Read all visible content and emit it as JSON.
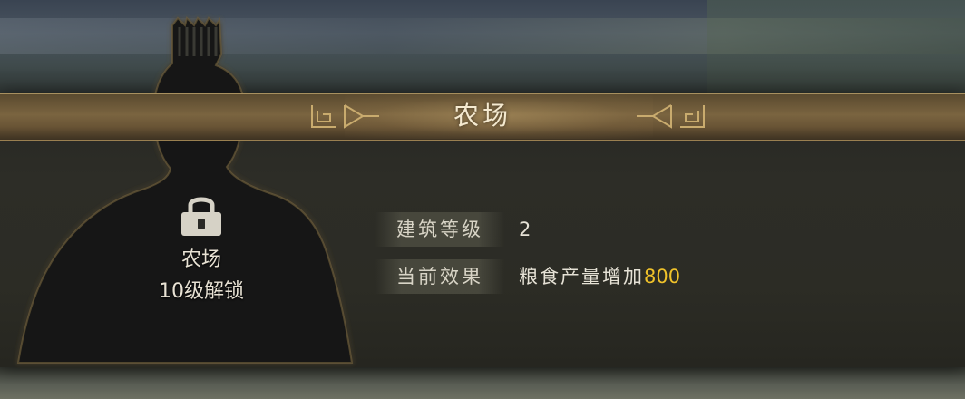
{
  "dialog": {
    "title": "农场"
  },
  "building_card": {
    "name": "农场",
    "unlock_requirement": "10级解锁",
    "icon": "lock-icon",
    "silhouette": "locked-character-silhouette"
  },
  "info": {
    "level_label": "建筑等级",
    "level_value": "2",
    "effect_label": "当前效果",
    "effect_text": "粮食产量增加",
    "effect_amount": "800"
  },
  "colors": {
    "title_text": "#f5ead0",
    "highlight": "#f0c22a",
    "title_bar": "#7a6440"
  }
}
